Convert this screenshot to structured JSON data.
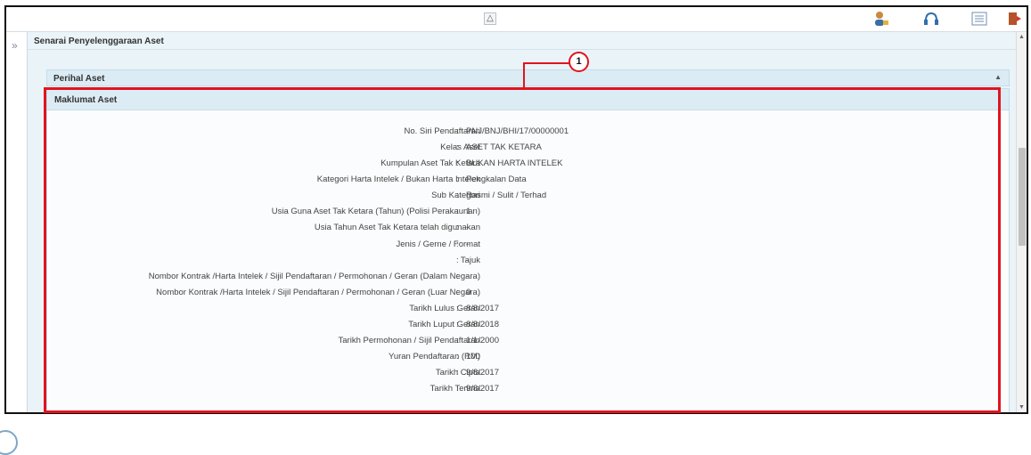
{
  "main_header": "Senarai Penyelenggaraan Aset",
  "section_title": "Perihal Aset",
  "panel_title": "Maklumat Aset",
  "callout_number": "1",
  "colors": {
    "highlight": "#e0141e",
    "header_bg": "#dcecf5"
  },
  "icons": [
    "collapse-up-icon",
    "user-icon",
    "headset-icon",
    "list-icon",
    "logout-icon",
    "expand-left-icon"
  ],
  "fields": [
    {
      "label": "No. Siri Pendaftaran",
      "value": "PNJ/BNJ/BHI/17/00000001"
    },
    {
      "label": "Kelas Aset",
      "value": "ASET TAK KETARA"
    },
    {
      "label": "Kumpulan Aset Tak Ketara",
      "value": "BUKAN HARTA INTELEK"
    },
    {
      "label": "Kategori Harta Intelek / Bukan Harta Intelek",
      "value": "Pengkalan Data"
    },
    {
      "label": "Sub Kategori",
      "value": "Rasmi / Sulit / Terhad"
    },
    {
      "label": "Usia Guna Aset Tak Ketara (Tahun) (Polisi Perakaunan)",
      "value": "1"
    },
    {
      "label": "Usia Tahun Aset Tak Ketara telah digunakan",
      "value": "-"
    },
    {
      "label": "Jenis / Gerne / Format",
      "value": "-"
    },
    {
      "label": "Tajuk",
      "value": "-"
    },
    {
      "label": "Nombor Kontrak /Harta Intelek / Sijil Pendaftaran / Permohonan / Geran (Dalam Negara)",
      "value": "-"
    },
    {
      "label": "Nombor Kontrak /Harta Intelek / Sijil Pendaftaran / Permohonan / Geran (Luar Negara)",
      "value": "0"
    },
    {
      "label": "Tarikh Lulus Geran",
      "value": "8/8/2017"
    },
    {
      "label": "Tarikh Luput Geran",
      "value": "8/8/2018"
    },
    {
      "label": "Tarikh Permohonan / Sijil Pendaftaran",
      "value": "1/1/2000"
    },
    {
      "label": "Yuran Pendaftaran (RM)",
      "value": "100"
    },
    {
      "label": "Tarikh Cipta",
      "value": "9/8/2017"
    },
    {
      "label": "Tarikh Terima",
      "value": "9/8/2017"
    }
  ]
}
